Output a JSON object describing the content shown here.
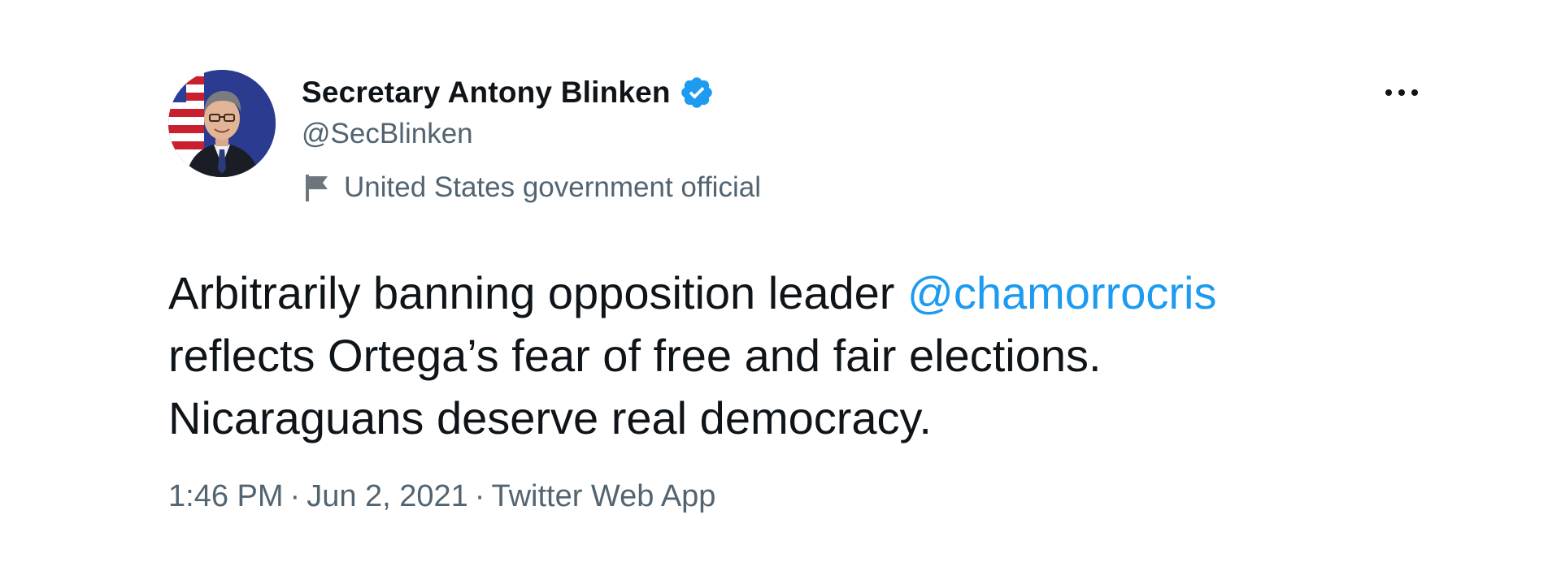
{
  "tweet": {
    "author": {
      "display_name": "Secretary Antony Blinken",
      "handle": "@SecBlinken",
      "verified": true,
      "avatar_icon": "person-portrait-with-us-flag",
      "account_label": "United States government official",
      "label_icon": "flag-icon"
    },
    "more_icon": "more-horizontal-icon",
    "text": {
      "line1_prefix": "Arbitrarily banning opposition leader ",
      "mention": "@chamorrocris",
      "line2": "reflects Ortega’s fear of free and fair elections.",
      "line3": "Nicaraguans deserve real democracy."
    },
    "meta": {
      "time": "1:46 PM",
      "date": "Jun 2, 2021",
      "source": "Twitter Web App",
      "separator": "·"
    }
  },
  "colors": {
    "text_primary": "#0f1419",
    "text_secondary": "#536471",
    "link": "#1d9bf0",
    "verified_badge": "#1d9bf0",
    "background": "#ffffff"
  }
}
